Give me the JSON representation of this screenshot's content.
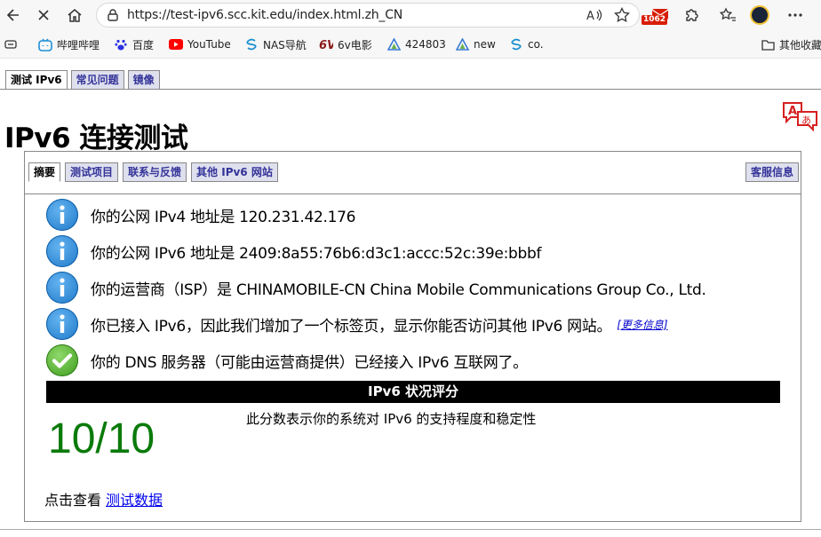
{
  "browser": {
    "url": "https://test-ipv6.scc.kit.edu/index.html.zh_CN",
    "mail_badge": "1062",
    "bookmarks": [
      {
        "label": "哔哩哔哩",
        "icon": "bilibili-icon"
      },
      {
        "label": "百度",
        "icon": "baidu-paw-icon"
      },
      {
        "label": "YouTube",
        "icon": "youtube-icon"
      },
      {
        "label": "NAS导航",
        "icon": "s-logo-icon"
      },
      {
        "label": "6v电影",
        "icon": "6v-logo-icon"
      },
      {
        "label": "424803",
        "icon": "triangle-logo-icon"
      },
      {
        "label": "new",
        "icon": "triangle-logo-icon"
      },
      {
        "label": "co.",
        "icon": "s-logo-icon"
      }
    ],
    "other_favorites": "其他收藏"
  },
  "page": {
    "top_tabs": [
      "测试 IPv6",
      "常见问题",
      "镜像"
    ],
    "title": "IPv6 连接测试",
    "sub_tabs": [
      "摘要",
      "测试项目",
      "联系与反馈",
      "其他 IPv6 网站"
    ],
    "help_tab": "客服信息",
    "messages": [
      {
        "type": "info",
        "text": "你的公网 IPv4 地址是 120.231.42.176"
      },
      {
        "type": "info",
        "text": "你的公网 IPv6 地址是 2409:8a55:76b6:d3c1:accc:52c:39e:bbbf"
      },
      {
        "type": "info",
        "text": "你的运营商（ISP）是 CHINAMOBILE-CN China Mobile Communications Group Co., Ltd."
      },
      {
        "type": "info",
        "text": "你已接入 IPv6，因此我们增加了一个标签页，显示你能否访问其他 IPv6 网站。",
        "more": "[更多信息]"
      },
      {
        "type": "ok",
        "text": "你的 DNS 服务器（可能由运营商提供）已经接入 IPv6 互联网了。"
      }
    ],
    "score_header": "IPv6 状况评分",
    "score_description": "此分数表示你的系统对 IPv6 的支持程度和稳定性",
    "score": "10/10",
    "view_prefix": "点击查看",
    "view_link": "测试数据"
  },
  "colors": {
    "score_green": "#0a7a0a",
    "tab_blue": "#333399",
    "info_blue": "#1e78c8",
    "ok_green": "#3c9b1c"
  }
}
